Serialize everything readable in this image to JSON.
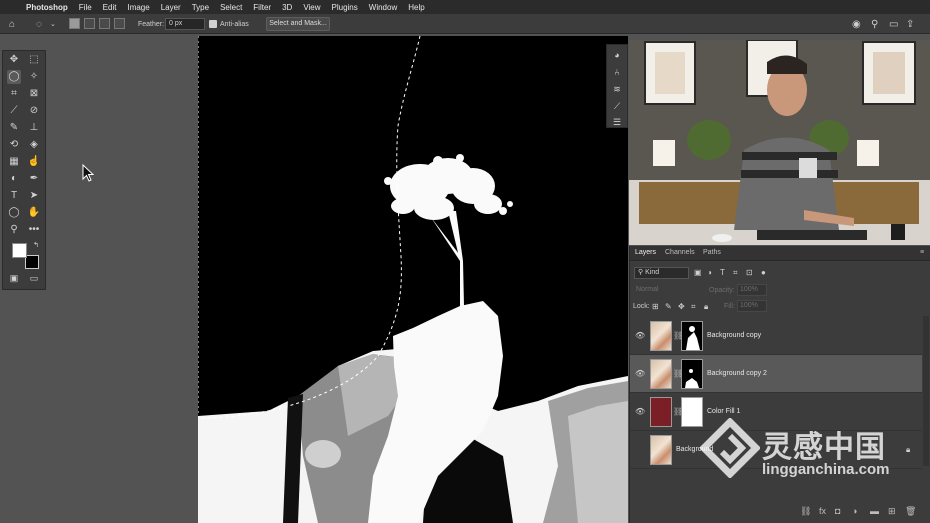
{
  "menubar": {
    "apple_glyph": "",
    "items": [
      "Photoshop",
      "File",
      "Edit",
      "Image",
      "Layer",
      "Type",
      "Select",
      "Filter",
      "3D",
      "View",
      "Plugins",
      "Window",
      "Help"
    ]
  },
  "options": {
    "feather_label": "Feather:",
    "feather_value": "0 px",
    "antialias_label": "Anti-alias",
    "select_mask_label": "Select and Mask..."
  },
  "layers_panel": {
    "tabs": [
      "Layers",
      "Channels",
      "Paths"
    ],
    "kind_label": "Kind",
    "blend_mode": "Normal",
    "opacity_label": "Opacity:",
    "opacity_value": "100%",
    "lock_label": "Lock:",
    "fill_label": "Fill:",
    "fill_value": "100%",
    "layers": [
      {
        "name": "Background copy",
        "selected": false
      },
      {
        "name": "Background copy 2",
        "selected": true
      },
      {
        "name": "Color Fill 1",
        "selected": false
      },
      {
        "name": "Background",
        "selected": false
      }
    ]
  },
  "watermark": {
    "cn": "灵感中国",
    "en": "lingganchina.com"
  },
  "colors": {
    "menubar_bg": "#2b2b2b",
    "panel_bg": "#3c3c3c",
    "workspace_bg": "#535353",
    "selected_layer": "#595959",
    "color_fill": "#7a1f25"
  },
  "icons": {
    "toolbar": [
      "move-icon",
      "marquee-icon",
      "lasso-icon",
      "magic-wand-icon",
      "crop-icon",
      "frame-icon",
      "eyedropper-icon",
      "healing-icon",
      "brush-icon",
      "stamp-icon",
      "history-brush-icon",
      "eraser-icon",
      "gradient-icon",
      "smudge-icon",
      "dodge-icon",
      "pen-icon",
      "type-icon",
      "path-select-icon",
      "shape-icon",
      "hand-icon",
      "zoom-icon",
      "more-icon"
    ]
  }
}
